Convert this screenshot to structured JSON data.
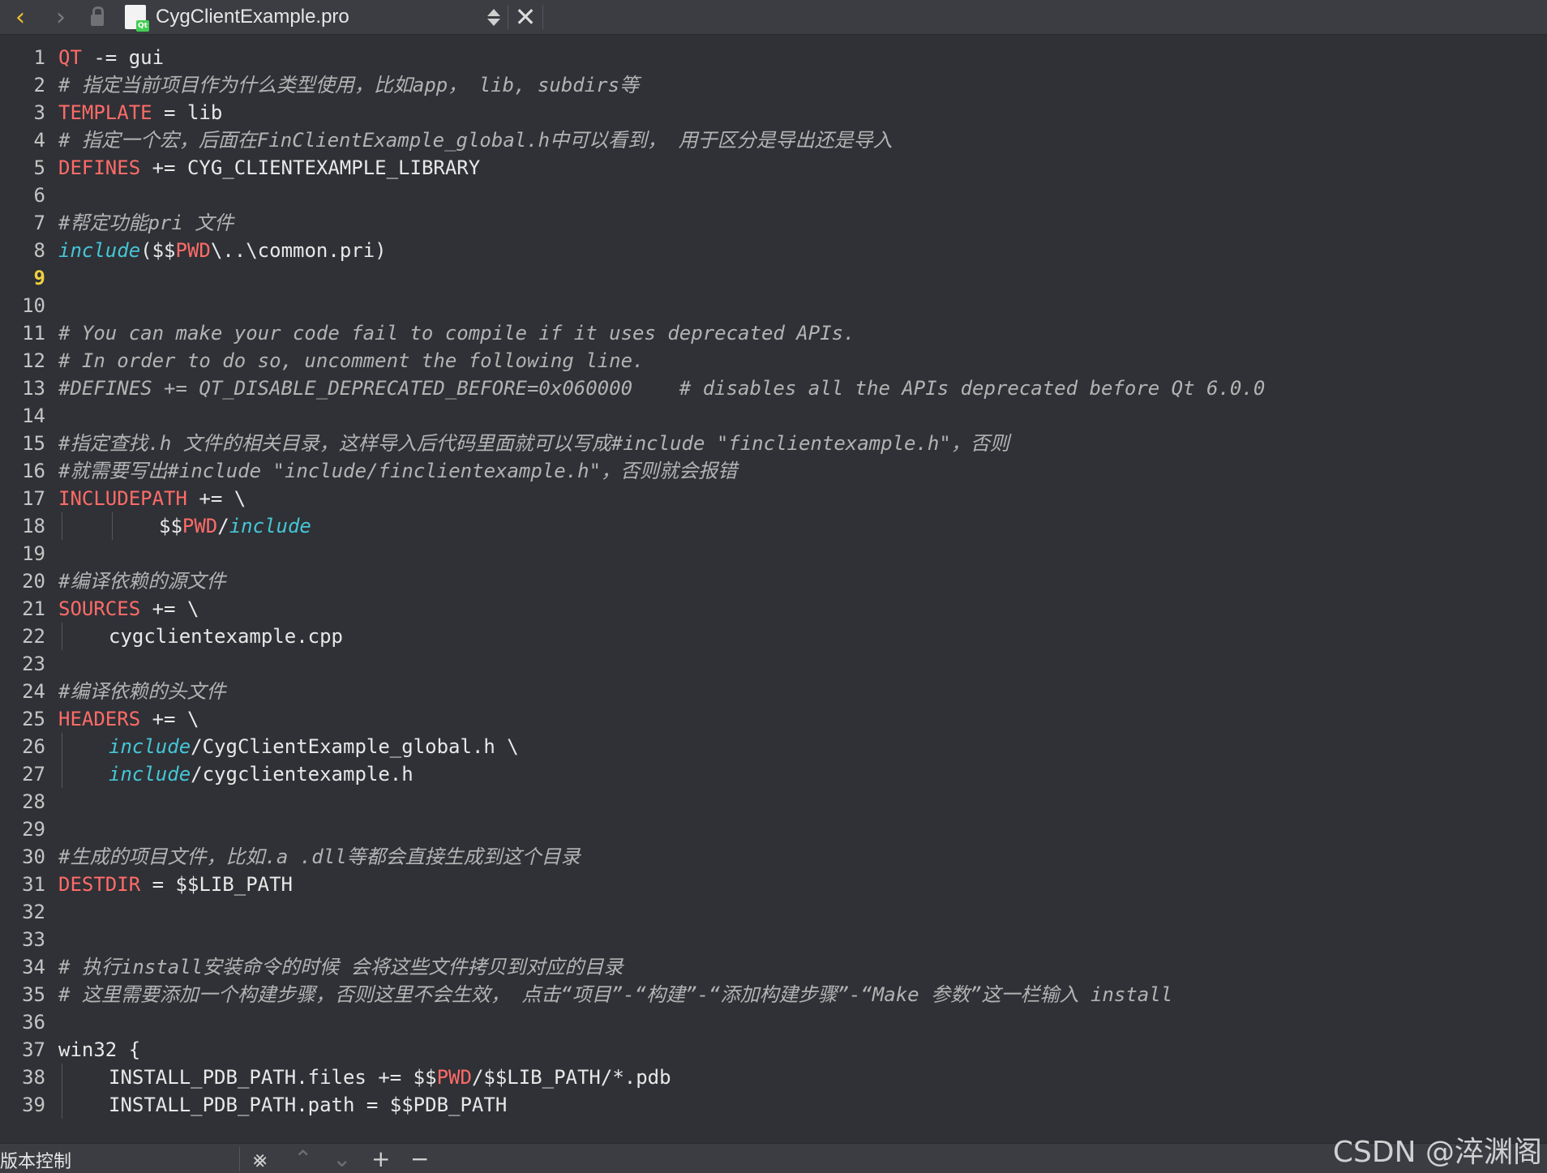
{
  "tab": {
    "back_icon": "chevron-left-icon",
    "forward_icon": "chevron-right-icon",
    "lock_icon": "lock-icon",
    "file_icon": "qt-project-file-icon",
    "title": "CygClientExample.pro",
    "close_icon": "close-icon"
  },
  "editor": {
    "current_line": 9,
    "lines": [
      {
        "n": "1",
        "segs": [
          {
            "t": "QT",
            "c": "kw"
          },
          {
            "t": " -= gui",
            "c": ""
          }
        ]
      },
      {
        "n": "2",
        "segs": [
          {
            "t": "# 指定当前项目作为什么类型使用，比如app， lib, subdirs等",
            "c": "cm"
          }
        ]
      },
      {
        "n": "3",
        "segs": [
          {
            "t": "TEMPLATE",
            "c": "kw"
          },
          {
            "t": " = lib",
            "c": ""
          }
        ]
      },
      {
        "n": "4",
        "segs": [
          {
            "t": "# 指定一个宏，后面在FinClientExample_global.h中可以看到， 用于区分是导出还是导入",
            "c": "cm"
          }
        ]
      },
      {
        "n": "5",
        "segs": [
          {
            "t": "DEFINES",
            "c": "kw"
          },
          {
            "t": " += CYG_CLIENTEXAMPLE_LIBRARY",
            "c": ""
          }
        ]
      },
      {
        "n": "6",
        "segs": []
      },
      {
        "n": "7",
        "segs": [
          {
            "t": "#帮定功能pri 文件",
            "c": "cm"
          }
        ]
      },
      {
        "n": "8",
        "segs": [
          {
            "t": "include",
            "c": "fn"
          },
          {
            "t": "($$",
            "c": ""
          },
          {
            "t": "PWD",
            "c": "kw"
          },
          {
            "t": "\\..\\common.pri)",
            "c": ""
          }
        ]
      },
      {
        "n": "9",
        "segs": []
      },
      {
        "n": "10",
        "segs": []
      },
      {
        "n": "11",
        "segs": [
          {
            "t": "# You can make your code fail to compile if it uses deprecated APIs.",
            "c": "cm"
          }
        ]
      },
      {
        "n": "12",
        "segs": [
          {
            "t": "# In order to do so, uncomment the following line.",
            "c": "cm"
          }
        ]
      },
      {
        "n": "13",
        "segs": [
          {
            "t": "#DEFINES += QT_DISABLE_DEPRECATED_BEFORE=0x060000    # disables all the APIs deprecated before Qt 6.0.0",
            "c": "cm"
          }
        ]
      },
      {
        "n": "14",
        "segs": []
      },
      {
        "n": "15",
        "segs": [
          {
            "t": "#指定查找.h 文件的相关目录，这样导入后代码里面就可以写成#include \"finclientexample.h\"，否则",
            "c": "cm"
          }
        ]
      },
      {
        "n": "16",
        "segs": [
          {
            "t": "#就需要写出#include \"include/finclientexample.h\"，否则就会报错",
            "c": "cm"
          }
        ]
      },
      {
        "n": "17",
        "segs": [
          {
            "t": "INCLUDEPATH",
            "c": "kw"
          },
          {
            "t": " += \\",
            "c": ""
          }
        ]
      },
      {
        "n": "18",
        "indent": 2,
        "segs": [
          {
            "t": "$$",
            "c": ""
          },
          {
            "t": "PWD",
            "c": "kw"
          },
          {
            "t": "/",
            "c": ""
          },
          {
            "t": "include",
            "c": "fn"
          }
        ]
      },
      {
        "n": "19",
        "segs": []
      },
      {
        "n": "20",
        "segs": [
          {
            "t": "#编译依赖的源文件",
            "c": "cm"
          }
        ]
      },
      {
        "n": "21",
        "segs": [
          {
            "t": "SOURCES",
            "c": "kw"
          },
          {
            "t": " += \\",
            "c": ""
          }
        ]
      },
      {
        "n": "22",
        "indent": 1,
        "segs": [
          {
            "t": "cygclientexample.cpp",
            "c": ""
          }
        ]
      },
      {
        "n": "23",
        "segs": []
      },
      {
        "n": "24",
        "segs": [
          {
            "t": "#编译依赖的头文件",
            "c": "cm"
          }
        ]
      },
      {
        "n": "25",
        "segs": [
          {
            "t": "HEADERS",
            "c": "kw"
          },
          {
            "t": " += \\",
            "c": ""
          }
        ]
      },
      {
        "n": "26",
        "indent": 1,
        "segs": [
          {
            "t": "include",
            "c": "fn"
          },
          {
            "t": "/CygClientExample_global.h \\",
            "c": ""
          }
        ]
      },
      {
        "n": "27",
        "indent": 1,
        "segs": [
          {
            "t": "include",
            "c": "fn"
          },
          {
            "t": "/cygclientexample.h",
            "c": ""
          }
        ]
      },
      {
        "n": "28",
        "segs": []
      },
      {
        "n": "29",
        "segs": []
      },
      {
        "n": "30",
        "segs": [
          {
            "t": "#生成的项目文件，比如.a .dll等都会直接生成到这个目录",
            "c": "cm"
          }
        ]
      },
      {
        "n": "31",
        "segs": [
          {
            "t": "DESTDIR",
            "c": "kw"
          },
          {
            "t": " = $$LIB_PATH",
            "c": ""
          }
        ]
      },
      {
        "n": "32",
        "segs": []
      },
      {
        "n": "33",
        "segs": []
      },
      {
        "n": "34",
        "segs": [
          {
            "t": "# 执行install安装命令的时候 会将这些文件拷贝到对应的目录",
            "c": "cm"
          }
        ]
      },
      {
        "n": "35",
        "segs": [
          {
            "t": "# 这里需要添加一个构建步骤，否则这里不会生效， 点击“项目”-“构建”-“添加构建步骤”-“Make 参数”这一栏输入 install",
            "c": "cm"
          }
        ]
      },
      {
        "n": "36",
        "segs": []
      },
      {
        "n": "37",
        "segs": [
          {
            "t": "win32 {",
            "c": ""
          }
        ]
      },
      {
        "n": "38",
        "indent": 1,
        "segs": [
          {
            "t": "INSTALL_PDB_PATH.files += $$",
            "c": ""
          },
          {
            "t": "PWD",
            "c": "kw"
          },
          {
            "t": "/$$LIB_PATH/*.pdb",
            "c": ""
          }
        ]
      },
      {
        "n": "39",
        "indent": 1,
        "segs": [
          {
            "t": "INSTALL_PDB_PATH.path = $$PDB_PATH",
            "c": ""
          }
        ]
      }
    ]
  },
  "bottom": {
    "version_control_label": "版本控制",
    "icons": [
      "filter-icon",
      "arrow-up-icon",
      "arrow-down-icon",
      "plus-icon",
      "minus-icon"
    ]
  },
  "watermark": "CSDN @淬渊阁"
}
